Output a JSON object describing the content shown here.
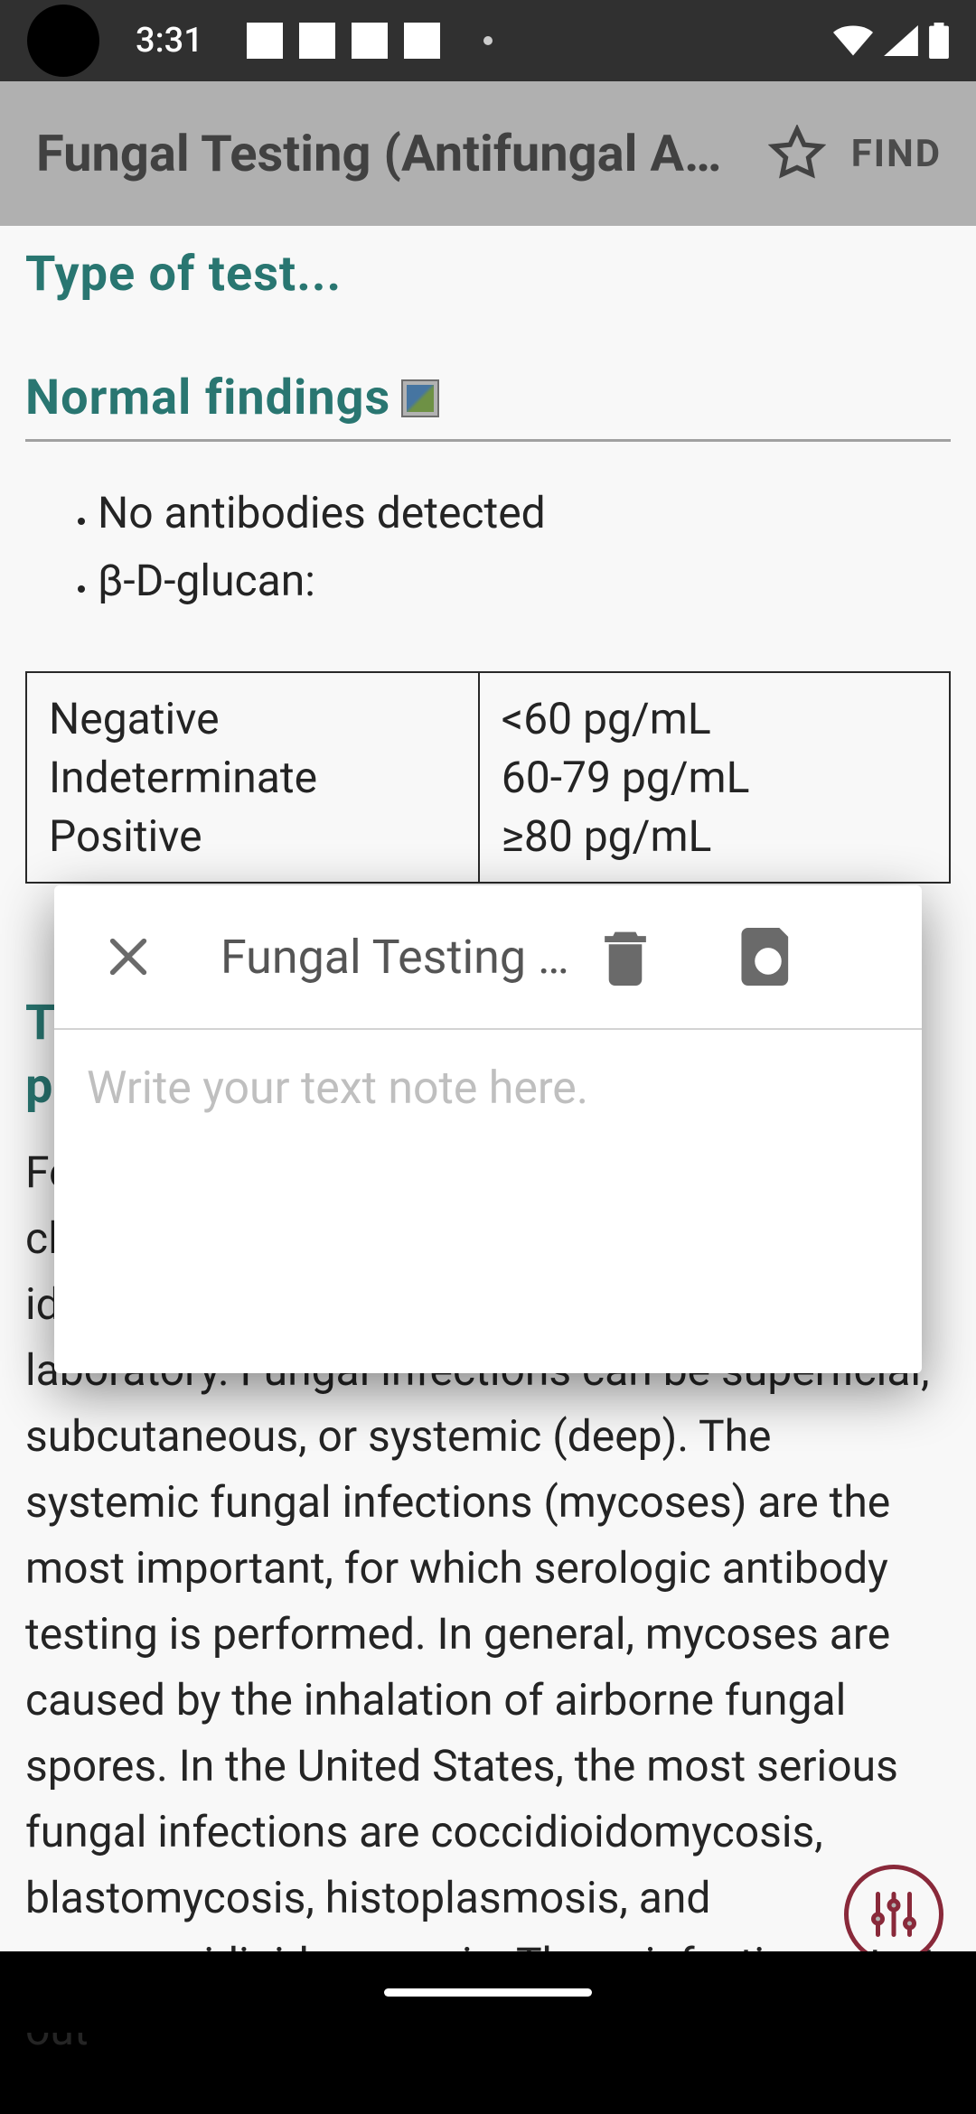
{
  "status": {
    "time": "3:31"
  },
  "app_bar": {
    "title": "Fungal Testing (Antifungal A…",
    "find_label": "FIND"
  },
  "sections": {
    "type": "Type of test...",
    "normal": "Normal findings"
  },
  "bullets": {
    "b1": "No antibodies detected",
    "b2": "β-D-glucan:"
  },
  "table": {
    "left": {
      "r1": "Negative",
      "r2": "Indeterminate",
      "r3": "Positive"
    },
    "right": {
      "r1": "<60 pg/mL",
      "r2": "60-79 pg/mL",
      "r3": "≥80 pg/mL"
    }
  },
  "peek": {
    "l1": "T",
    "l2": "p"
  },
  "body": "Few fungal diseases can be diagnosed clinically; many are diagnosed by isolating and identifying the infecting fungus in the clinical laboratory. Fungal infections can be superficial, subcutaneous, or systemic (deep). The systemic fungal infections (mycoses) are the most important, for which serologic antibody testing is performed. In general, mycoses are caused by the inhalation of airborne fungal spores. In the United States, the most serious fungal infections are coccidioidomycosis, blastomycosis, histoplasmosis, and paracoccidioidomycosis. These infections start out",
  "modal": {
    "title": "Fungal Testing …",
    "placeholder": "Write your text note here."
  }
}
